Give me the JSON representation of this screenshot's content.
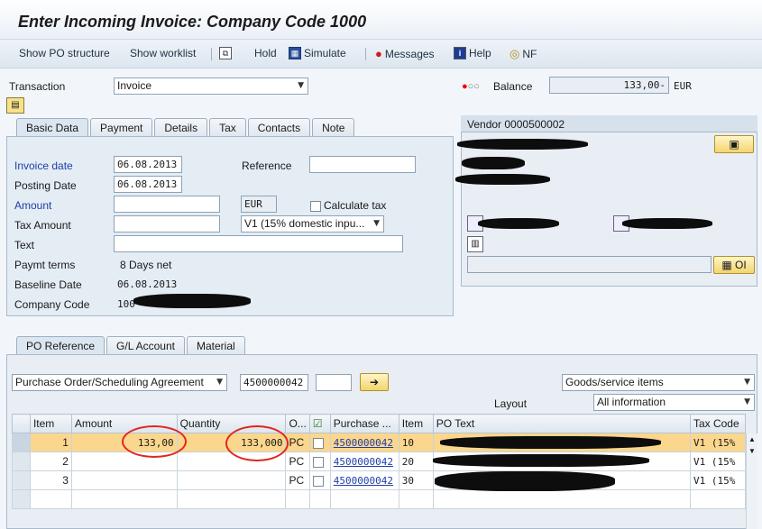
{
  "title": "Enter Incoming Invoice: Company Code 1000",
  "toolbar": {
    "show_po_structure": "Show PO structure",
    "show_worklist": "Show worklist",
    "hold": "Hold",
    "simulate": "Simulate",
    "messages": "Messages",
    "help": "Help",
    "nf": "NF"
  },
  "transaction": {
    "label": "Transaction",
    "value": "Invoice"
  },
  "balance": {
    "label": "Balance",
    "value": "133,00-",
    "currency": "EUR"
  },
  "tabs": [
    "Basic Data",
    "Payment",
    "Details",
    "Tax",
    "Contacts",
    "Note"
  ],
  "basic": {
    "invoice_date_label": "Invoice date",
    "invoice_date": "06.08.2013",
    "reference_label": "Reference",
    "posting_date_label": "Posting Date",
    "posting_date": "06.08.2013",
    "amount_label": "Amount",
    "currency": "EUR",
    "calc_tax_label": "Calculate tax",
    "tax_amount_label": "Tax Amount",
    "tax_code": "V1 (15% domestic inpu...",
    "text_label": "Text",
    "paymt_terms_label": "Paymt terms",
    "paymt_terms": "8 Days net",
    "baseline_label": "Baseline Date",
    "baseline": "06.08.2013",
    "company_label": "Company Code",
    "company": "100"
  },
  "vendor": {
    "title": "Vendor 0000500002",
    "oi": "OI"
  },
  "ref_tabs": [
    "PO Reference",
    "G/L Account",
    "Material"
  ],
  "po": {
    "type": "Purchase Order/Scheduling Agreement",
    "number": "4500000042",
    "goods": "Goods/service items",
    "layout_label": "Layout",
    "layout": "All information"
  },
  "grid": {
    "headers": [
      "Item",
      "Amount",
      "Quantity",
      "O...",
      "",
      "Purchase ...",
      "Item",
      "PO Text",
      "Tax Code"
    ],
    "rows": [
      {
        "item": "1",
        "amount": "133,00",
        "qty": "133,000",
        "unit": "PC",
        "po": "4500000042",
        "po_item": "10",
        "tax": "V1  (15%"
      },
      {
        "item": "2",
        "amount": "",
        "qty": "",
        "unit": "PC",
        "po": "4500000042",
        "po_item": "20",
        "tax": "V1  (15%"
      },
      {
        "item": "3",
        "amount": "",
        "qty": "",
        "unit": "PC",
        "po": "4500000042",
        "po_item": "30",
        "tax": "V1  (15%"
      }
    ]
  }
}
